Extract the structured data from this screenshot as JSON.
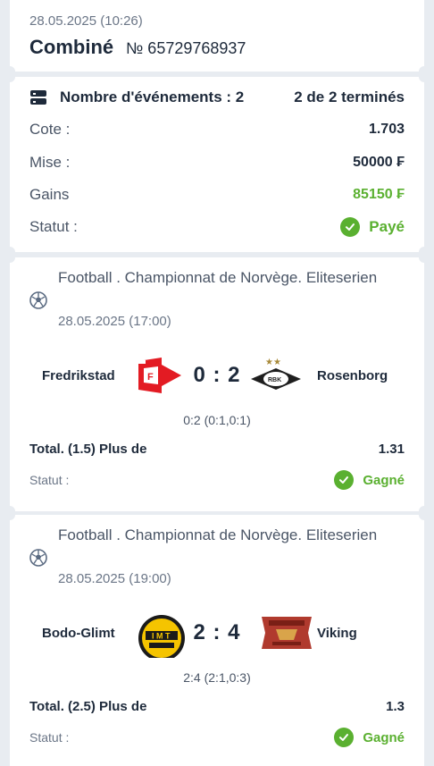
{
  "header": {
    "date": "28.05.2025 (10:26)",
    "type": "Combiné",
    "number": "№ 65729768937"
  },
  "summary": {
    "events_label": "Nombre d'événements : 2",
    "events_value": "2 de 2 terminés",
    "odds_label": "Cote :",
    "odds_value": "1.703",
    "stake_label": "Mise :",
    "stake_value": "50000 ₣",
    "winnings_label": "Gains",
    "winnings_value": "85150 ₣",
    "status_label": "Statut :",
    "status_value": "Payé"
  },
  "events": [
    {
      "league": "Football . Championnat de Norvège. Eliteserien",
      "date": "28.05.2025 (17:00)",
      "team1": "Fredrikstad",
      "team2": "Rosenborg",
      "score": "0 : 2",
      "score_detail": "0:2 (0:1,0:1)",
      "bet": "Total. (1.5) Plus de",
      "odds": "1.31",
      "status_label": "Statut :",
      "status_value": "Gagné"
    },
    {
      "league": "Football . Championnat de Norvège. Eliteserien",
      "date": "28.05.2025 (19:00)",
      "team1": "Bodo-Glimt",
      "team2": "Viking",
      "score": "2 : 4",
      "score_detail": "2:4 (2:1,0:3)",
      "bet": "Total. (2.5) Plus de",
      "odds": "1.3",
      "status_label": "Statut :",
      "status_value": "Gagné"
    }
  ],
  "colors": {
    "success": "#5ab030",
    "text": "#1e2a3b",
    "muted": "#6b7687",
    "background": "#e8ecf1"
  }
}
